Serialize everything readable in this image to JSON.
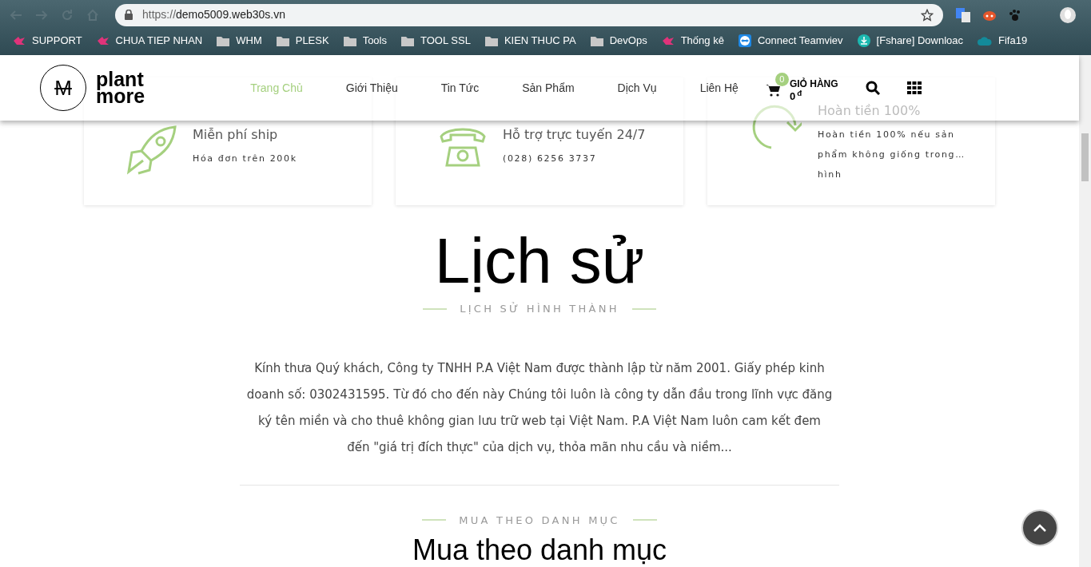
{
  "browser": {
    "url_scheme": "https://",
    "url_host": "demo5009.web30s.vn",
    "bookmarks": [
      {
        "label": "SUPPORT",
        "kind": "logo"
      },
      {
        "label": "CHUA TIEP NHAN",
        "kind": "logo"
      },
      {
        "label": "WHM",
        "kind": "folder"
      },
      {
        "label": "PLESK",
        "kind": "folder"
      },
      {
        "label": "Tools",
        "kind": "folder"
      },
      {
        "label": "TOOL SSL",
        "kind": "folder"
      },
      {
        "label": "KIEN THUC PA",
        "kind": "folder"
      },
      {
        "label": "DevOps",
        "kind": "folder"
      },
      {
        "label": "Thống kê",
        "kind": "logo"
      },
      {
        "label": "Connect Teamviev",
        "kind": "teamviewer"
      },
      {
        "label": "[Fshare] Downloac",
        "kind": "download"
      },
      {
        "label": "Fifa19",
        "kind": "cloud"
      }
    ]
  },
  "header": {
    "logo": {
      "mark": "M",
      "line1": "plant",
      "line2": "more"
    },
    "nav": [
      {
        "label": "Trang Chủ",
        "selected": true
      },
      {
        "label": "Giới Thiệu",
        "selected": false
      },
      {
        "label": "Tin Tức",
        "selected": false
      },
      {
        "label": "Sản Phẩm",
        "selected": false
      },
      {
        "label": "Dịch Vụ",
        "selected": false
      },
      {
        "label": "Liên Hệ",
        "selected": false
      }
    ],
    "cart": {
      "count": "0",
      "label": "GIỎ HÀNG",
      "total": "0",
      "currency": "đ"
    }
  },
  "features": [
    {
      "kind": "rocket",
      "title": "Miễn phí ship",
      "lines": [
        "Hóa đơn trên 200k"
      ]
    },
    {
      "kind": "phone",
      "title": "Hỗ trợ trực tuyến 24/7",
      "lines": [
        "(028) 6256 3737"
      ]
    },
    {
      "kind": "refresh",
      "title": "Hoàn tiền 100%",
      "lines": [
        "Hoàn tiền 100% nếu sản",
        "phẩm không giống trong…",
        "hình"
      ]
    }
  ],
  "history": {
    "title": "Lịch sử",
    "subtitle": "LỊCH SỬ HÌNH THÀNH",
    "body": "Kính thưa Quý khách, Công ty TNHH P.A Việt Nam được thành lập từ năm 2001. Giấy phép kinh doanh số: 0302431595. Từ đó cho đến này Chúng tôi luôn là công ty dẫn đầu trong lĩnh vực đăng ký tên miền và cho thuê không gian lưu trữ web tại Việt Nam. P.A Việt Nam luôn cam kết đem đến \"giá trị đích thực\" của dịch vụ, thỏa mãn nhu cầu và niềm..."
  },
  "categories": {
    "subtitle": "MUA THEO DANH MỤC",
    "title": "Mua theo danh mục"
  }
}
